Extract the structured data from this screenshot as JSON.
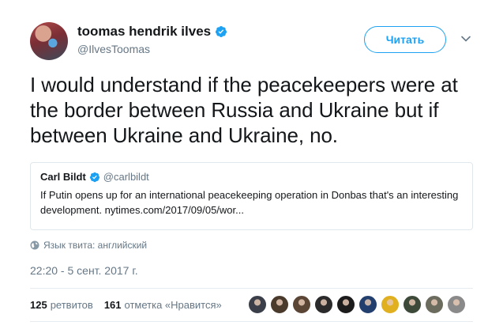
{
  "author": {
    "display_name": "toomas hendrik ilves",
    "handle": "@IlvesToomas",
    "verified": true
  },
  "follow_button_label": "Читать",
  "tweet_text": "I would understand if the peacekeepers were at the border between Russia and Ukraine but if between Ukraine and Ukraine, no.",
  "quoted_tweet": {
    "display_name": "Carl Bildt",
    "handle": "@carlbildt",
    "verified": true,
    "text": "If Putin opens up for an international peacekeeping operation in Donbas that's an interesting development.  nytimes.com/2017/09/05/wor..."
  },
  "language_note": "Язык твита: английский",
  "timestamp": "22:20 - 5 сент. 2017 г.",
  "stats": {
    "retweets_count": "125",
    "retweets_label": "ретвитов",
    "likes_count": "161",
    "likes_label": "отметка «Нравится»"
  },
  "likers": [
    {
      "icon": "liker-avatar-1",
      "color": "#3a3f4a"
    },
    {
      "icon": "liker-avatar-2",
      "color": "#4a3a2c"
    },
    {
      "icon": "liker-avatar-3",
      "color": "#5b4636"
    },
    {
      "icon": "liker-avatar-4",
      "color": "#2b2b2b"
    },
    {
      "icon": "liker-avatar-5",
      "color": "#1c1c1c"
    },
    {
      "icon": "liker-avatar-6",
      "color": "#223f6e"
    },
    {
      "icon": "liker-avatar-7",
      "color": "#e0b020"
    },
    {
      "icon": "liker-avatar-8",
      "color": "#3d4a3a"
    },
    {
      "icon": "liker-avatar-9",
      "color": "#6b6b5e"
    },
    {
      "icon": "liker-avatar-10",
      "color": "#8a8a8a"
    }
  ],
  "colors": {
    "accent": "#1da1f2",
    "text": "#14171a",
    "secondary": "#657786",
    "border": "#e1e8ed"
  }
}
